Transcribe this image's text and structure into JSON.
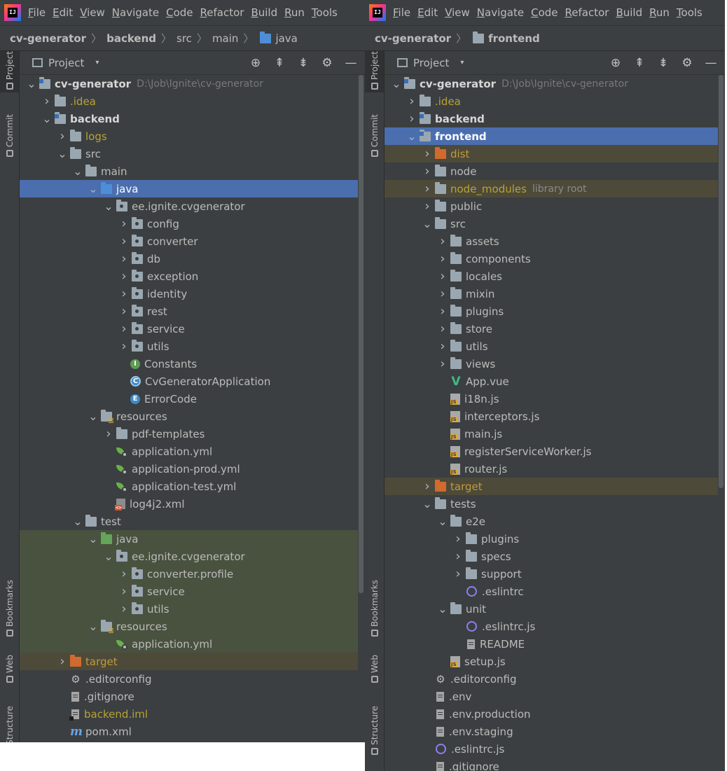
{
  "left": {
    "logo_text": "IJ",
    "menu": [
      "File",
      "Edit",
      "View",
      "Navigate",
      "Code",
      "Refactor",
      "Build",
      "Run",
      "Tools"
    ],
    "breadcrumbs": [
      "cv-generator",
      "backend",
      "src",
      "main",
      "java"
    ],
    "panel": {
      "title": "Project",
      "dropdown": "▾",
      "tools": [
        "⊕",
        "⇞",
        "⇟",
        "⚙",
        "—"
      ]
    },
    "stripe": [
      "Project",
      "Commit",
      "Bookmarks",
      "Web",
      "Structure"
    ],
    "tree": [
      {
        "d": 0,
        "exp": true,
        "icon": "module",
        "label": "cv-generator",
        "bold": true,
        "path": "D:\\Job\\Ignite\\cv-generator"
      },
      {
        "d": 1,
        "exp": false,
        "icon": "folder",
        "label": ".idea",
        "style": "yellow"
      },
      {
        "d": 1,
        "exp": true,
        "icon": "module",
        "label": "backend",
        "bold": true
      },
      {
        "d": 2,
        "exp": false,
        "icon": "folder",
        "label": "logs",
        "style": "yellow"
      },
      {
        "d": 2,
        "exp": true,
        "icon": "folder",
        "label": "src"
      },
      {
        "d": 3,
        "exp": true,
        "icon": "folder",
        "label": "main"
      },
      {
        "d": 4,
        "exp": true,
        "icon": "folder-blue",
        "label": "java",
        "row": "sel"
      },
      {
        "d": 5,
        "exp": true,
        "icon": "pkg",
        "label": "ee.ignite.cvgenerator"
      },
      {
        "d": 6,
        "exp": false,
        "icon": "pkg",
        "label": "config"
      },
      {
        "d": 6,
        "exp": false,
        "icon": "pkg",
        "label": "converter"
      },
      {
        "d": 6,
        "exp": false,
        "icon": "pkg",
        "label": "db"
      },
      {
        "d": 6,
        "exp": false,
        "icon": "pkg",
        "label": "exception"
      },
      {
        "d": 6,
        "exp": false,
        "icon": "pkg",
        "label": "identity"
      },
      {
        "d": 6,
        "exp": false,
        "icon": "pkg",
        "label": "rest"
      },
      {
        "d": 6,
        "exp": false,
        "icon": "pkg",
        "label": "service"
      },
      {
        "d": 6,
        "exp": false,
        "icon": "pkg",
        "label": "utils"
      },
      {
        "d": 6,
        "icon": "interface",
        "label": "Constants",
        "badge": "I"
      },
      {
        "d": 6,
        "icon": "class",
        "label": "CvGeneratorApplication",
        "badge": "C"
      },
      {
        "d": 6,
        "icon": "enum",
        "label": "ErrorCode",
        "badge": "E"
      },
      {
        "d": 4,
        "exp": true,
        "icon": "res",
        "label": "resources"
      },
      {
        "d": 5,
        "exp": false,
        "icon": "folder",
        "label": "pdf-templates"
      },
      {
        "d": 5,
        "icon": "spring",
        "label": "application.yml"
      },
      {
        "d": 5,
        "icon": "spring",
        "label": "application-prod.yml"
      },
      {
        "d": 5,
        "icon": "spring",
        "label": "application-test.yml"
      },
      {
        "d": 5,
        "icon": "xml",
        "label": "log4j2.xml"
      },
      {
        "d": 3,
        "exp": true,
        "icon": "folder",
        "label": "test"
      },
      {
        "d": 4,
        "exp": true,
        "icon": "folder-green",
        "label": "java",
        "row": "test"
      },
      {
        "d": 5,
        "exp": true,
        "icon": "pkg",
        "label": "ee.ignite.cvgenerator",
        "row": "test"
      },
      {
        "d": 6,
        "exp": false,
        "icon": "pkg",
        "label": "converter.profile",
        "row": "test"
      },
      {
        "d": 6,
        "exp": false,
        "icon": "pkg",
        "label": "service",
        "row": "test"
      },
      {
        "d": 6,
        "exp": false,
        "icon": "pkg",
        "label": "utils",
        "row": "test"
      },
      {
        "d": 4,
        "exp": true,
        "icon": "res",
        "label": "resources",
        "row": "test"
      },
      {
        "d": 5,
        "icon": "spring",
        "label": "application.yml",
        "row": "test"
      },
      {
        "d": 2,
        "exp": false,
        "icon": "folder-orange",
        "label": "target",
        "style": "orange",
        "row": "excl"
      },
      {
        "d": 2,
        "icon": "gear",
        "label": ".editorconfig"
      },
      {
        "d": 2,
        "icon": "file",
        "label": ".gitignore"
      },
      {
        "d": 2,
        "icon": "iml",
        "label": "backend.iml",
        "style": "yellow"
      },
      {
        "d": 2,
        "icon": "maven",
        "label": "pom.xml"
      }
    ]
  },
  "right": {
    "logo_text": "IJ",
    "menu": [
      "File",
      "Edit",
      "View",
      "Navigate",
      "Code",
      "Refactor",
      "Build",
      "Run",
      "Tools"
    ],
    "breadcrumbs": [
      "cv-generator",
      "frontend"
    ],
    "panel": {
      "title": "Project",
      "dropdown": "▾",
      "tools": [
        "⊕",
        "⇞",
        "⇟",
        "⚙",
        "—"
      ]
    },
    "stripe": [
      "Project",
      "Commit",
      "Bookmarks",
      "Web",
      "Structure"
    ],
    "tree": [
      {
        "d": 0,
        "exp": true,
        "icon": "module",
        "label": "cv-generator",
        "bold": true,
        "path": "D:\\Job\\Ignite\\cv-generator"
      },
      {
        "d": 1,
        "exp": false,
        "icon": "folder",
        "label": ".idea",
        "style": "yellow"
      },
      {
        "d": 1,
        "exp": false,
        "icon": "module",
        "label": "backend",
        "bold": true
      },
      {
        "d": 1,
        "exp": true,
        "icon": "module",
        "label": "frontend",
        "bold": true,
        "row": "sel"
      },
      {
        "d": 2,
        "exp": false,
        "icon": "folder-orange",
        "label": "dist",
        "style": "orange",
        "row": "excl"
      },
      {
        "d": 2,
        "exp": false,
        "icon": "folder",
        "label": "node"
      },
      {
        "d": 2,
        "exp": false,
        "icon": "folder",
        "label": "node_modules",
        "style": "yellow",
        "row": "excl",
        "hint": "library root"
      },
      {
        "d": 2,
        "exp": false,
        "icon": "folder",
        "label": "public"
      },
      {
        "d": 2,
        "exp": true,
        "icon": "folder",
        "label": "src"
      },
      {
        "d": 3,
        "exp": false,
        "icon": "folder",
        "label": "assets"
      },
      {
        "d": 3,
        "exp": false,
        "icon": "folder",
        "label": "components"
      },
      {
        "d": 3,
        "exp": false,
        "icon": "folder",
        "label": "locales"
      },
      {
        "d": 3,
        "exp": false,
        "icon": "folder",
        "label": "mixin"
      },
      {
        "d": 3,
        "exp": false,
        "icon": "folder",
        "label": "plugins"
      },
      {
        "d": 3,
        "exp": false,
        "icon": "folder",
        "label": "store"
      },
      {
        "d": 3,
        "exp": false,
        "icon": "folder",
        "label": "utils"
      },
      {
        "d": 3,
        "exp": false,
        "icon": "folder",
        "label": "views"
      },
      {
        "d": 3,
        "icon": "vue",
        "label": "App.vue"
      },
      {
        "d": 3,
        "icon": "js",
        "label": "i18n.js"
      },
      {
        "d": 3,
        "icon": "js",
        "label": "interceptors.js"
      },
      {
        "d": 3,
        "icon": "js",
        "label": "main.js"
      },
      {
        "d": 3,
        "icon": "js",
        "label": "registerServiceWorker.js"
      },
      {
        "d": 3,
        "icon": "js",
        "label": "router.js"
      },
      {
        "d": 2,
        "exp": false,
        "icon": "folder-orange",
        "label": "target",
        "style": "orange",
        "row": "excl"
      },
      {
        "d": 2,
        "exp": true,
        "icon": "folder",
        "label": "tests"
      },
      {
        "d": 3,
        "exp": true,
        "icon": "folder",
        "label": "e2e"
      },
      {
        "d": 4,
        "exp": false,
        "icon": "folder",
        "label": "plugins"
      },
      {
        "d": 4,
        "exp": false,
        "icon": "folder",
        "label": "specs"
      },
      {
        "d": 4,
        "exp": false,
        "icon": "folder",
        "label": "support"
      },
      {
        "d": 4,
        "icon": "eslint",
        "label": ".eslintrc"
      },
      {
        "d": 3,
        "exp": true,
        "icon": "folder",
        "label": "unit"
      },
      {
        "d": 4,
        "icon": "eslint",
        "label": ".eslintrc.js"
      },
      {
        "d": 4,
        "icon": "readme",
        "label": "README"
      },
      {
        "d": 3,
        "icon": "js",
        "label": "setup.js"
      },
      {
        "d": 2,
        "icon": "gear",
        "label": ".editorconfig"
      },
      {
        "d": 2,
        "icon": "file",
        "label": ".env"
      },
      {
        "d": 2,
        "icon": "file",
        "label": ".env.production"
      },
      {
        "d": 2,
        "icon": "file",
        "label": ".env.staging"
      },
      {
        "d": 2,
        "icon": "eslint",
        "label": ".eslintrc.js"
      },
      {
        "d": 2,
        "icon": "file",
        "label": ".gitignore"
      }
    ]
  }
}
